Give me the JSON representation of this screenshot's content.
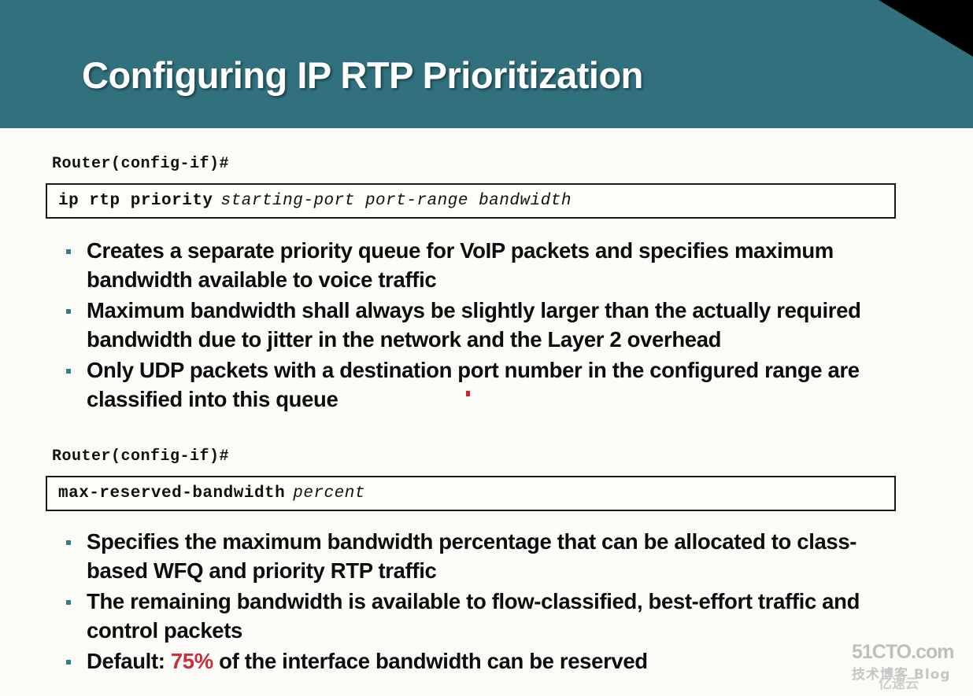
{
  "slide": {
    "title": "Configuring IP RTP Prioritization",
    "theme": {
      "header_teal": "#30717d",
      "body_background": "#fbfcf8",
      "bullet_teal": "#2e7d8c",
      "highlight_red": "#c9303a",
      "corner_wedge": "#000000",
      "title_color": "#ffffff",
      "text_color": "#0d0d0d"
    }
  },
  "sections": [
    {
      "prompt": "Router(config-if)#",
      "command": {
        "keyword": "ip rtp priority",
        "arguments": "starting-port port-range bandwidth"
      },
      "bullets": [
        "Creates a separate priority queue for VoIP packets and specifies maximum bandwidth available to voice traffic",
        "Maximum bandwidth shall always be slightly larger than the actually required bandwidth due to jitter in the network and the Layer 2 overhead",
        "Only UDP packets with a destination port number in the configured range are classified into this queue"
      ]
    },
    {
      "prompt": "Router(config-if)#",
      "command": {
        "keyword": "max-reserved-bandwidth",
        "arguments": "percent"
      },
      "bullets": [
        "Specifies the maximum bandwidth percentage that can be allocated to class-based WFQ and priority RTP traffic",
        "The remaining bandwidth is available to flow-classified, best-effort traffic and control packets"
      ],
      "final_bullet": {
        "prefix": "Default: ",
        "highlight": "75%",
        "suffix": " of the interface bandwidth can be reserved"
      }
    }
  ],
  "watermark": {
    "main": "51CTO.com",
    "sub": "技术博客  Blog",
    "cloud": "亿速云"
  }
}
